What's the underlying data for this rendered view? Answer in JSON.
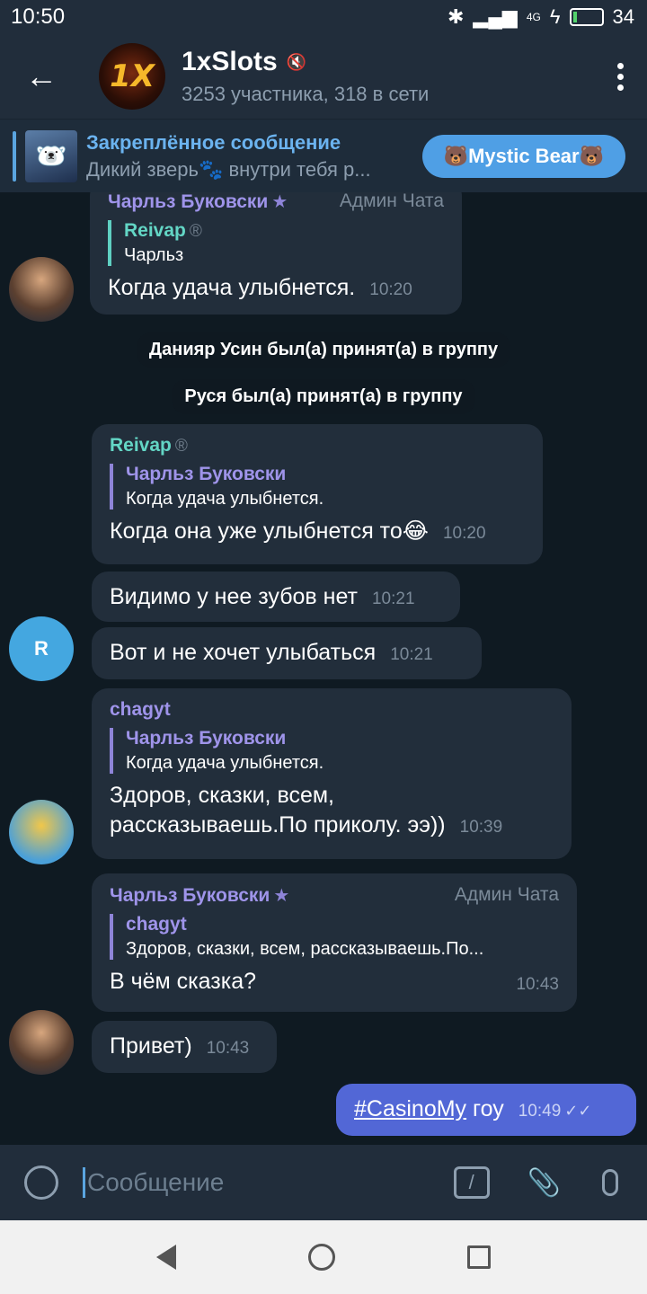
{
  "status": {
    "time": "10:50",
    "network": "4G LTE",
    "battery": "34"
  },
  "header": {
    "avatar_text": "1X",
    "title": "1xSlots",
    "subtitle": "3253 участника, 318 в сети"
  },
  "pinned": {
    "title": "Закреплённое сообщение",
    "body": "Дикий зверь🐾 внутри тебя р...",
    "button": "🐻Mystic Bear🐻"
  },
  "messages": {
    "m1": {
      "sender": "Чарльз Буковски",
      "role": "Админ Чата",
      "quote_name": "Reivap",
      "quote_text": "Чарльз",
      "text": "Когда удача улыбнется.",
      "time": "10:20"
    },
    "svc1": "Данияр Усин был(а) принят(а) в группу",
    "svc2": "Руся был(а) принят(а) в группу",
    "m2": {
      "sender": "Reivap",
      "quote_name": "Чарльз Буковски",
      "quote_text": "Когда удача улыбнется.",
      "text": "Когда она уже улыбнется то😂",
      "time": "10:20"
    },
    "m3": {
      "text": "Видимо у нее зубов нет",
      "time": "10:21"
    },
    "m4": {
      "text": "Вот и не хочет улыбаться",
      "time": "10:21"
    },
    "m4_avatar": "R",
    "m5": {
      "sender": "chagyt",
      "quote_name": "Чарльз Буковски",
      "quote_text": "Когда удача улыбнется.",
      "text_line1": "Здоров, сказки,  всем,",
      "text_line2": "рассказываешь.По приколу. ээ))",
      "time": "10:39"
    },
    "m6": {
      "sender": "Чарльз Буковски",
      "role": "Админ Чата",
      "quote_name": "chagyt",
      "quote_text": "Здоров, сказки,  всем, рассказываешь.По...",
      "text": "В  чём сказка?",
      "time": "10:43"
    },
    "m7": {
      "text": "Привет)",
      "time": "10:43"
    },
    "m8": {
      "hashtag": "#CasinoMy",
      "text": "гоу",
      "time": "10:49"
    }
  },
  "composer": {
    "placeholder": "Сообщение"
  }
}
